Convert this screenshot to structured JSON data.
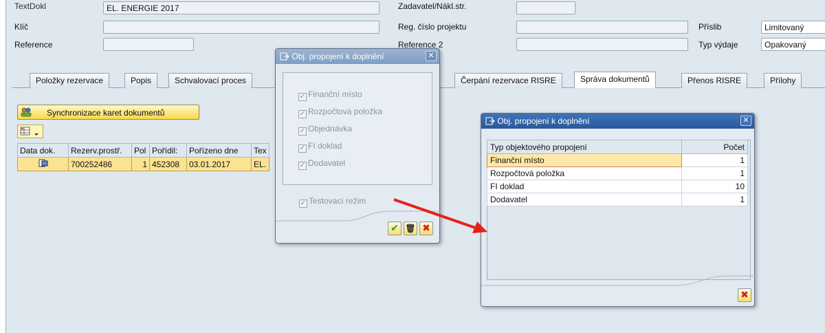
{
  "header": {
    "text_label": "TextDokl",
    "text_value": "EL. ENERGIE 2017",
    "key_label": "Klíč",
    "reference_label": "Reference",
    "zadavatel_label": "Zadavatel/Nákl.str.",
    "reg_label": "Reg. číslo projektu",
    "reference2_label": "Reference 2",
    "prislib_label": "Příslib",
    "prislib_value": "Limitovaný",
    "typ_vydaje_label": "Typ výdaje",
    "typ_vydaje_value": "Opakovaný"
  },
  "tabs": [
    {
      "label": "Položky rezervace"
    },
    {
      "label": "Popis"
    },
    {
      "label": "Schvalovací proces"
    },
    {
      "label": "Čerpání rezervace RISRE"
    },
    {
      "label": "Správa dokumentů"
    },
    {
      "label": "Přenos RISRE"
    },
    {
      "label": "Přílohy"
    }
  ],
  "toolbar": {
    "sync_label": "Synchronizace karet dokumentů"
  },
  "table": {
    "headers": [
      "Data dok.",
      "Rezerv.prostř.",
      "Pol",
      "Pořídil:",
      "Pořízeno dne",
      "Tex"
    ],
    "rows": [
      {
        "rezerv": "700252486",
        "pol": "1",
        "poridil": "452308",
        "date": "03.01.2017",
        "text": "EL."
      }
    ]
  },
  "dialog1": {
    "title": "Obj. propojení k doplnění",
    "checkboxes": [
      "Finanční místo",
      "Rozpočtová položka",
      "Objednávka",
      "FI doklad",
      "Dodavatel"
    ],
    "test_mode": "Testovací režim"
  },
  "dialog2": {
    "title": "Obj. propojení k doplnění",
    "col_type": "Typ objektového propojení",
    "col_count": "Počet",
    "rows": [
      {
        "type": "Finanční místo",
        "count": "1"
      },
      {
        "type": "Rozpočtová položka",
        "count": "1"
      },
      {
        "type": "FI doklad",
        "count": "10"
      },
      {
        "type": "Dodavatel",
        "count": "1"
      }
    ]
  },
  "colors": {
    "arrow": "#e8201a",
    "title_active": "#2a589a",
    "selection": "#fbe392"
  }
}
